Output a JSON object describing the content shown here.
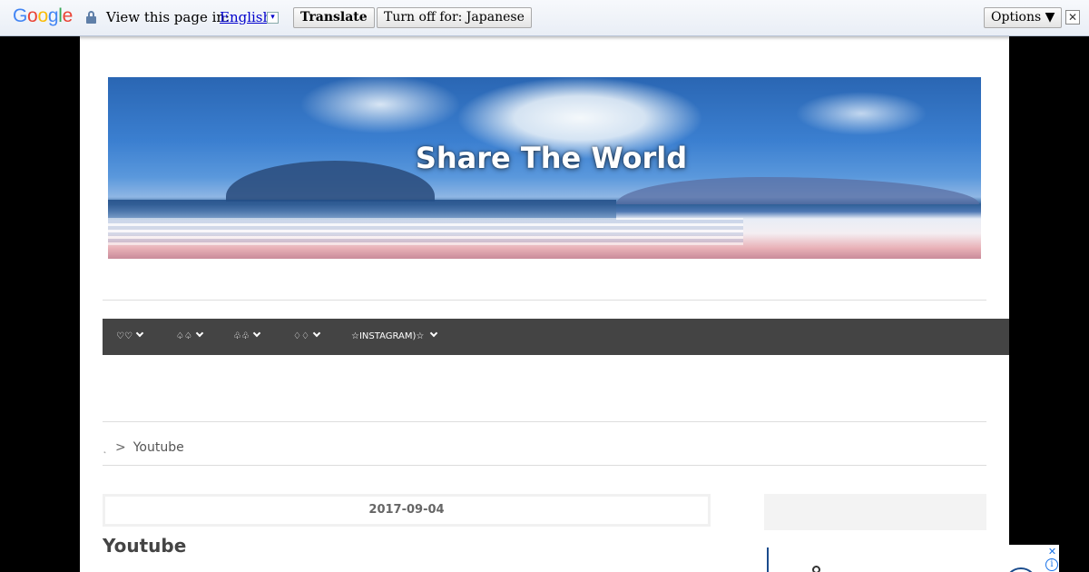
{
  "translate_bar": {
    "logo": [
      "G",
      "o",
      "o",
      "g",
      "l",
      "e"
    ],
    "prompt": "View this page in:",
    "language": "English",
    "language_arrow": "▾",
    "translate_button": "Translate",
    "turn_off_button": "Turn off for: Japanese",
    "options_button": "Options ▼",
    "close": "✕"
  },
  "header": {
    "site_title": "Share The World"
  },
  "nav": {
    "items": [
      {
        "label": "♡♡"
      },
      {
        "label": "♤♤"
      },
      {
        "label": "♧♧"
      },
      {
        "label": "♢♢"
      },
      {
        "label": "☆INSTAGRAM)☆"
      }
    ]
  },
  "breadcrumb": {
    "home": "˛",
    "separator": ">",
    "current": "Youtube"
  },
  "post": {
    "date": "2017-09-04",
    "title": "Youtube"
  },
  "ad": {
    "close": "✕",
    "info": "i"
  }
}
